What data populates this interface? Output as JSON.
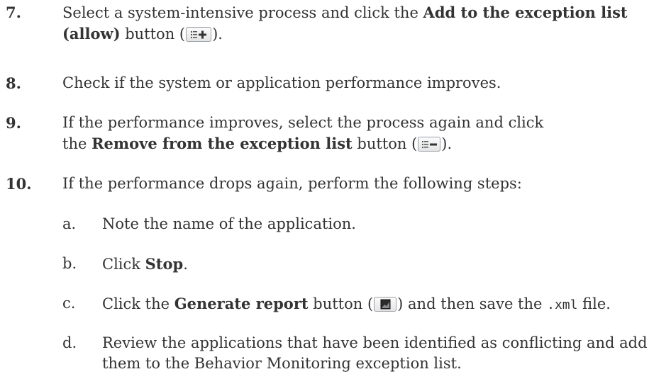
{
  "steps": [
    {
      "number": "7.",
      "pre": "Select a system-intensive process and click the ",
      "bold": "Add to the exception list (allow)",
      "post_open": " button (",
      "post_close": ")."
    },
    {
      "number": "8.",
      "text": "Check if the system or application performance improves."
    },
    {
      "number": "9.",
      "pre": "If the performance improves, select the process again and click the ",
      "bold": "Remove from the exception list",
      "post_open": " button (",
      "post_close": ")."
    },
    {
      "number": "10.",
      "text": "If the performance drops again, perform the following steps:"
    }
  ],
  "substeps": [
    {
      "letter": "a.",
      "text": "Note the name of the application."
    },
    {
      "letter": "b.",
      "pre": "Click ",
      "bold": "Stop",
      "post": "."
    },
    {
      "letter": "c.",
      "pre": "Click the ",
      "bold": "Generate report",
      "mid_open": " button (",
      "mid_close": ") and then save the ",
      "code": ".xml",
      "post": " file."
    },
    {
      "letter": "d.",
      "text": "Review the applications that have been identified as conflicting and add them to the Behavior Monitoring exception list."
    }
  ],
  "icons": {
    "add": "add-to-list-icon",
    "remove": "remove-from-list-icon",
    "report": "generate-report-icon"
  }
}
